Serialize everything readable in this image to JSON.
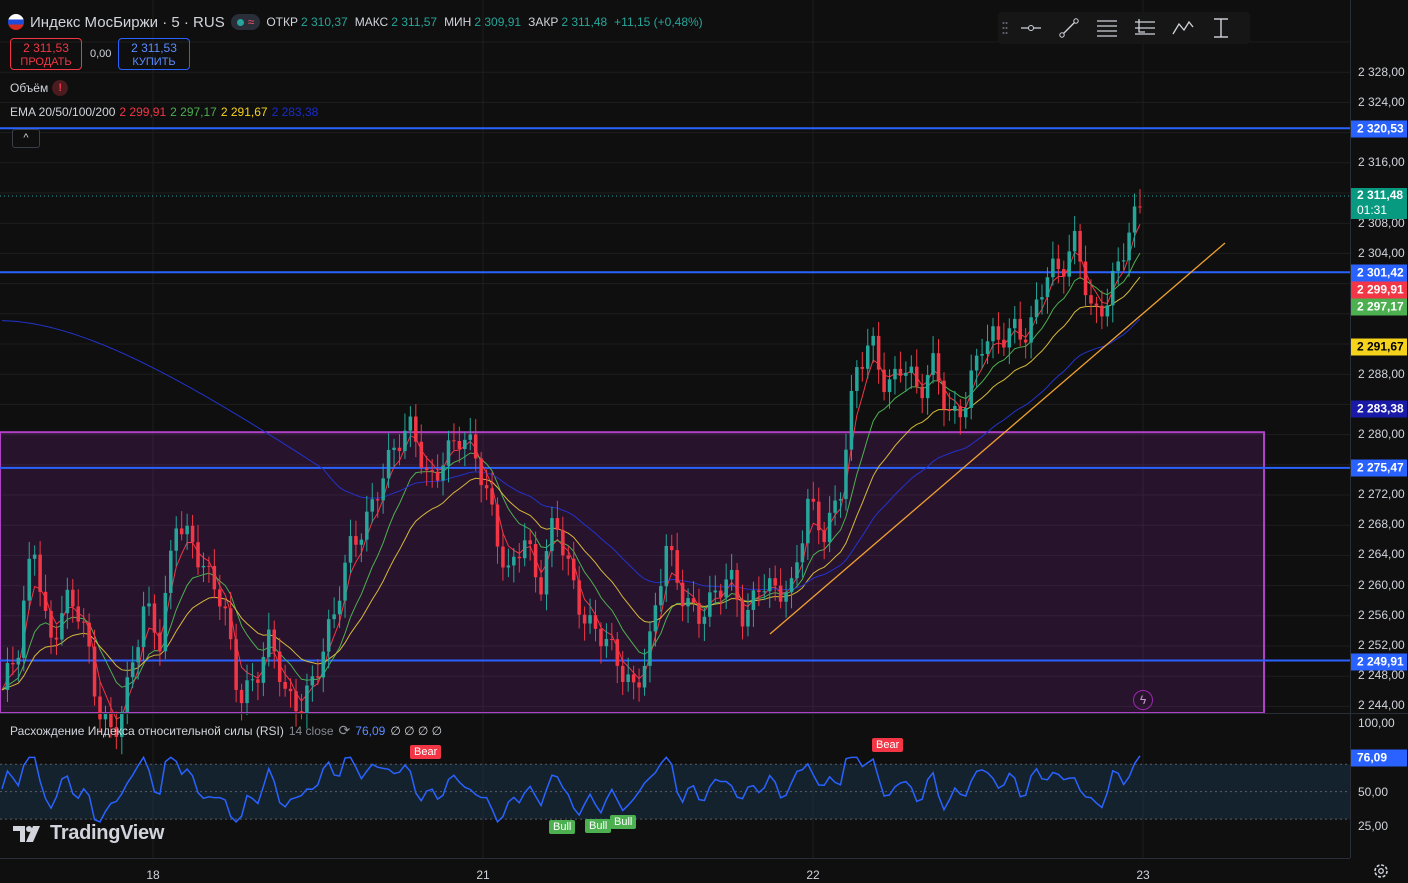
{
  "symbol": {
    "title": "Индекс МосБиржи · 5 · RUS",
    "open_label": "ОТКР",
    "open": "2 310,37",
    "high_label": "МАКС",
    "high": "2 311,57",
    "low_label": "МИН",
    "low": "2 309,91",
    "close_label": "ЗАКР",
    "close": "2 311,48",
    "change": "+11,15 (+0,48%)"
  },
  "trade": {
    "sell_price": "2 311,53",
    "sell_label": "ПРОДАТЬ",
    "spread": "0,00",
    "buy_price": "2 311,53",
    "buy_label": "КУПИТЬ"
  },
  "volume_label": "Объём",
  "ema": {
    "label": "EMA 20/50/100/200",
    "v20": "2 299,91",
    "v50": "2 297,17",
    "v100": "2 291,67",
    "v200": "2 283,38"
  },
  "toolbar_value": "point",
  "price_ticks": [
    "2 328,00",
    "2 324,00",
    "2 316,00",
    "2 308,00",
    "2 304,00",
    "2 288,00",
    "2 280,00",
    "2 272,00",
    "2 268,00",
    "2 264,00",
    "2 260,00",
    "2 256,00",
    "2 252,00",
    "2 248,00",
    "2 244,00"
  ],
  "price_tags": {
    "level1": "2 320,53",
    "last": "2 311,48",
    "countdown": "01:31",
    "level2": "2 301,42",
    "ema20": "2 299,91",
    "ema50": "2 297,17",
    "ema100": "2 291,67",
    "ema200": "2 283,38",
    "level3": "2 275,47",
    "level4": "2 249,91"
  },
  "rsi": {
    "title": "Расхождение Индекса относительной силы (RSI)",
    "params": "14 close",
    "value": "76,09",
    "placeholders": "∅ ∅ ∅ ∅",
    "ticks": [
      "100,00",
      "50,00",
      "25,00"
    ],
    "tag": "76,09",
    "bear_label": "Bear",
    "bull_label": "Bull"
  },
  "time_labels": [
    "18",
    "21",
    "22",
    "23"
  ],
  "brand": "TradingView",
  "colors": {
    "up": "#26a69a",
    "down": "#f23645",
    "level": "#2962ff",
    "ema20": "#f23645",
    "ema50": "#4caf50",
    "ema100": "#d4b83a",
    "ema200": "#2233cc",
    "zone": "#9c27b0",
    "trend": "#f0a030",
    "rsi": "#2962ff"
  },
  "chart_data": {
    "type": "candlestick",
    "title": "Индекс МосБиржи · 5 · RUS",
    "ylim": [
      2242,
      2330
    ],
    "x_labels": [
      "18",
      "21",
      "22",
      "23"
    ],
    "horizontal_levels": [
      2320.53,
      2301.42,
      2275.47,
      2249.91
    ],
    "zone": {
      "from": 2242,
      "to": 2280.2
    },
    "last_price": 2311.48,
    "ema": {
      "20": 2299.91,
      "50": 2297.17,
      "100": 2291.67,
      "200": 2283.38
    },
    "close_path": [
      2246,
      2250,
      2266,
      2253,
      2258,
      2255,
      2244,
      2241,
      2247,
      2256,
      2252,
      2270,
      2266,
      2260,
      2257,
      2246,
      2248,
      2252,
      2244,
      2245,
      2250,
      2255,
      2264,
      2269,
      2275,
      2278,
      2280,
      2274,
      2278,
      2279,
      2276,
      2270,
      2262,
      2266,
      2258,
      2270,
      2262,
      2254,
      2252,
      2250,
      2247,
      2252,
      2264,
      2259,
      2257,
      2258,
      2260,
      2255,
      2262,
      2259,
      2258,
      2271,
      2268,
      2272,
      2287,
      2292,
      2287,
      2290,
      2284,
      2289,
      2283,
      2285,
      2291,
      2292,
      2295,
      2294,
      2300,
      2301,
      2307,
      2296,
      2297,
      2304,
      2311.5
    ],
    "rsi": {
      "ylim": [
        0,
        100
      ],
      "overbought": 70,
      "middle": 50,
      "oversold": 30,
      "last": 76.09
    }
  }
}
